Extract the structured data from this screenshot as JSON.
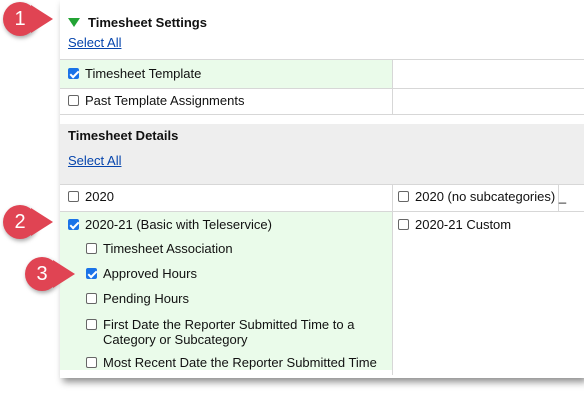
{
  "settings": {
    "title": "Timesheet Settings",
    "select_all": "Select All",
    "items": [
      {
        "label": "Timesheet Template",
        "checked": true
      },
      {
        "label": "Past Template Assignments",
        "checked": false
      }
    ]
  },
  "details": {
    "title": "Timesheet Details",
    "select_all": "Select All",
    "col1": [
      {
        "label": "2020",
        "checked": false
      },
      {
        "label": "2020-21 (Basic with Teleservice)",
        "checked": true
      }
    ],
    "col2": [
      {
        "label": "2020 (no subcategories) _",
        "checked": false
      },
      {
        "label": "2020-21 Custom",
        "checked": false
      }
    ],
    "subitems": [
      {
        "label": "Timesheet Association",
        "checked": false
      },
      {
        "label": "Approved Hours",
        "checked": true
      },
      {
        "label": "Pending Hours",
        "checked": false
      },
      {
        "label": "First Date the Reporter Submitted Time to a",
        "label_line2": "Category or Subcategory",
        "checked": false
      },
      {
        "label": "Most Recent Date the Reporter Submitted Time",
        "checked": false
      }
    ]
  },
  "markers": [
    "1",
    "2",
    "3"
  ],
  "colors": {
    "marker": "#e04453",
    "selected_row": "#eafbea",
    "link": "#0645ad",
    "checkbox_on": "#1a73e8"
  }
}
